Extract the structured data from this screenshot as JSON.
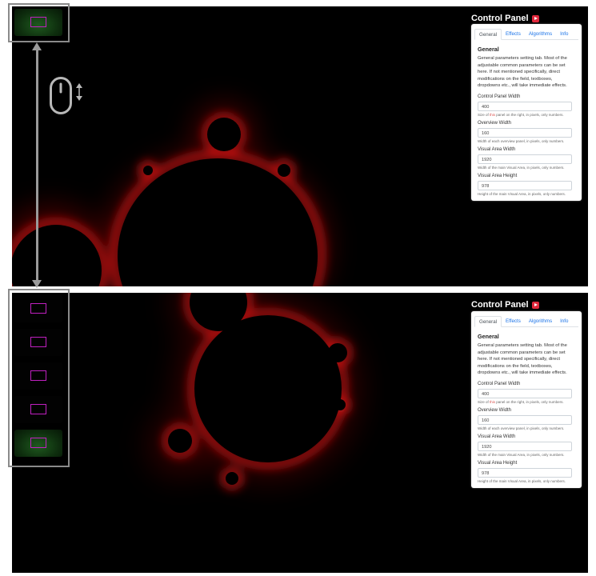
{
  "control_panel": {
    "title": "Control Panel",
    "tabs": [
      "General",
      "Effects",
      "Algorithms",
      "Info"
    ],
    "active_tab": "General",
    "heading": "General",
    "description": "General parameters setting tab. Most of the adjustable common parameters can be set here. If not mentioned specifically, direct modifications on the field, textboxes, dropdowns etc., will take immediate effects.",
    "fields": [
      {
        "label": "Control Panel Width",
        "value": "400",
        "help_before": "Size of ",
        "help_highlight": "this",
        "help_after": " panel on the right, in pixels, only numbers."
      },
      {
        "label": "Overview Width",
        "value": "160",
        "help_before": "Width of each overview panel, in pixels, only numbers.",
        "help_highlight": "",
        "help_after": ""
      },
      {
        "label": "Visual Area Width",
        "value": "1920",
        "help_before": "Width of the main Visual Area, in pixels, only numbers.",
        "help_highlight": "",
        "help_after": ""
      },
      {
        "label": "Visual Area Height",
        "value": "978",
        "help_before": "Height of the main Visual Area, in pixels, only numbers.",
        "help_highlight": "",
        "help_after": ""
      }
    ]
  },
  "overview": {
    "top_thumbnail_count": 1,
    "bottom_thumbnail_count": 5,
    "active_thumbnail_index": 4
  },
  "icons": {
    "mouse": "mouse-scroll-icon",
    "scroll": "up-down-arrows-icon",
    "youtube": "video-play-icon"
  },
  "colors": {
    "fractal_glow": "#c81010",
    "frame": "#8a8a8a",
    "highlight": "#c020c0",
    "active_thumb": "#1f5a1f"
  }
}
